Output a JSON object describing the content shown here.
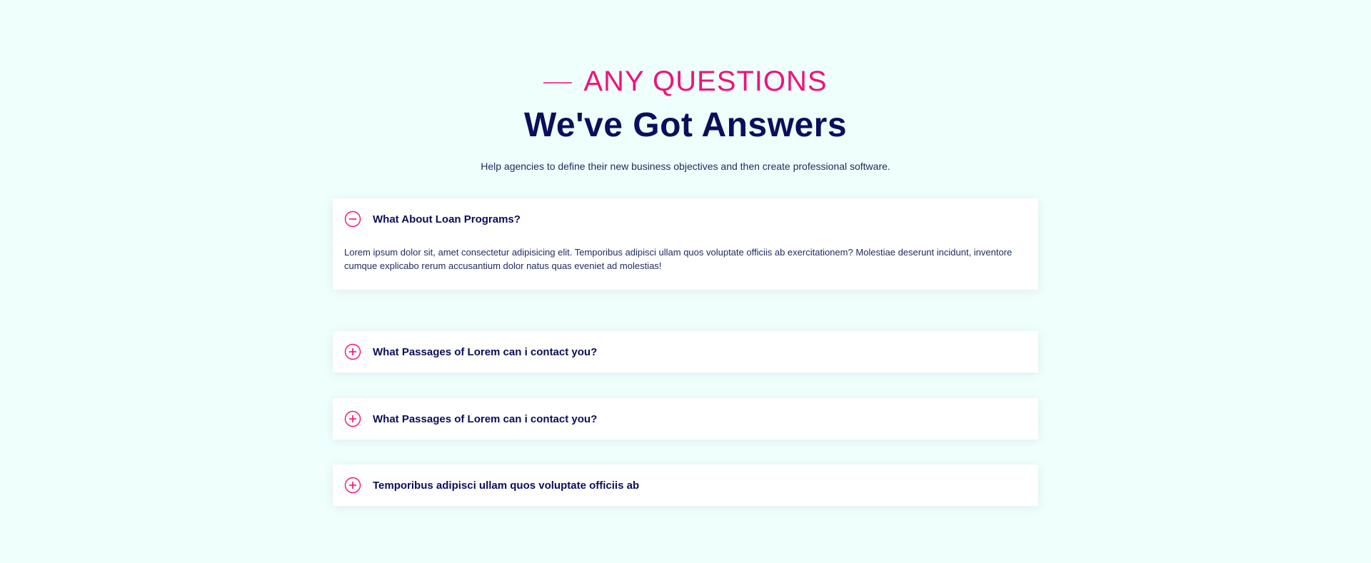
{
  "section": {
    "eyebrow": "ANY QUESTIONS",
    "title": "We've Got Answers",
    "subtitle": "Help agencies to define their new business objectives and then create professional software."
  },
  "colors": {
    "accent": "#f0127a",
    "heading": "#0b0e5c",
    "background": "#effffc",
    "card": "#ffffff"
  },
  "faqs": [
    {
      "question": "What About Loan Programs?",
      "answer": "Lorem ipsum dolor sit, amet consectetur adipisicing elit. Temporibus adipisci ullam quos voluptate officiis ab exercitationem? Molestiae deserunt incidunt, inventore cumque explicabo rerum accusantium dolor natus quas eveniet ad molestias!",
      "expanded": true,
      "icon": "minus-circle-icon"
    },
    {
      "question": "What Passages of Lorem can i contact you?",
      "expanded": false,
      "icon": "plus-circle-icon"
    },
    {
      "question": "What Passages of Lorem can i contact you?",
      "expanded": false,
      "icon": "plus-circle-icon"
    },
    {
      "question": "Temporibus adipisci ullam quos voluptate officiis ab",
      "expanded": false,
      "icon": "plus-circle-icon"
    }
  ]
}
